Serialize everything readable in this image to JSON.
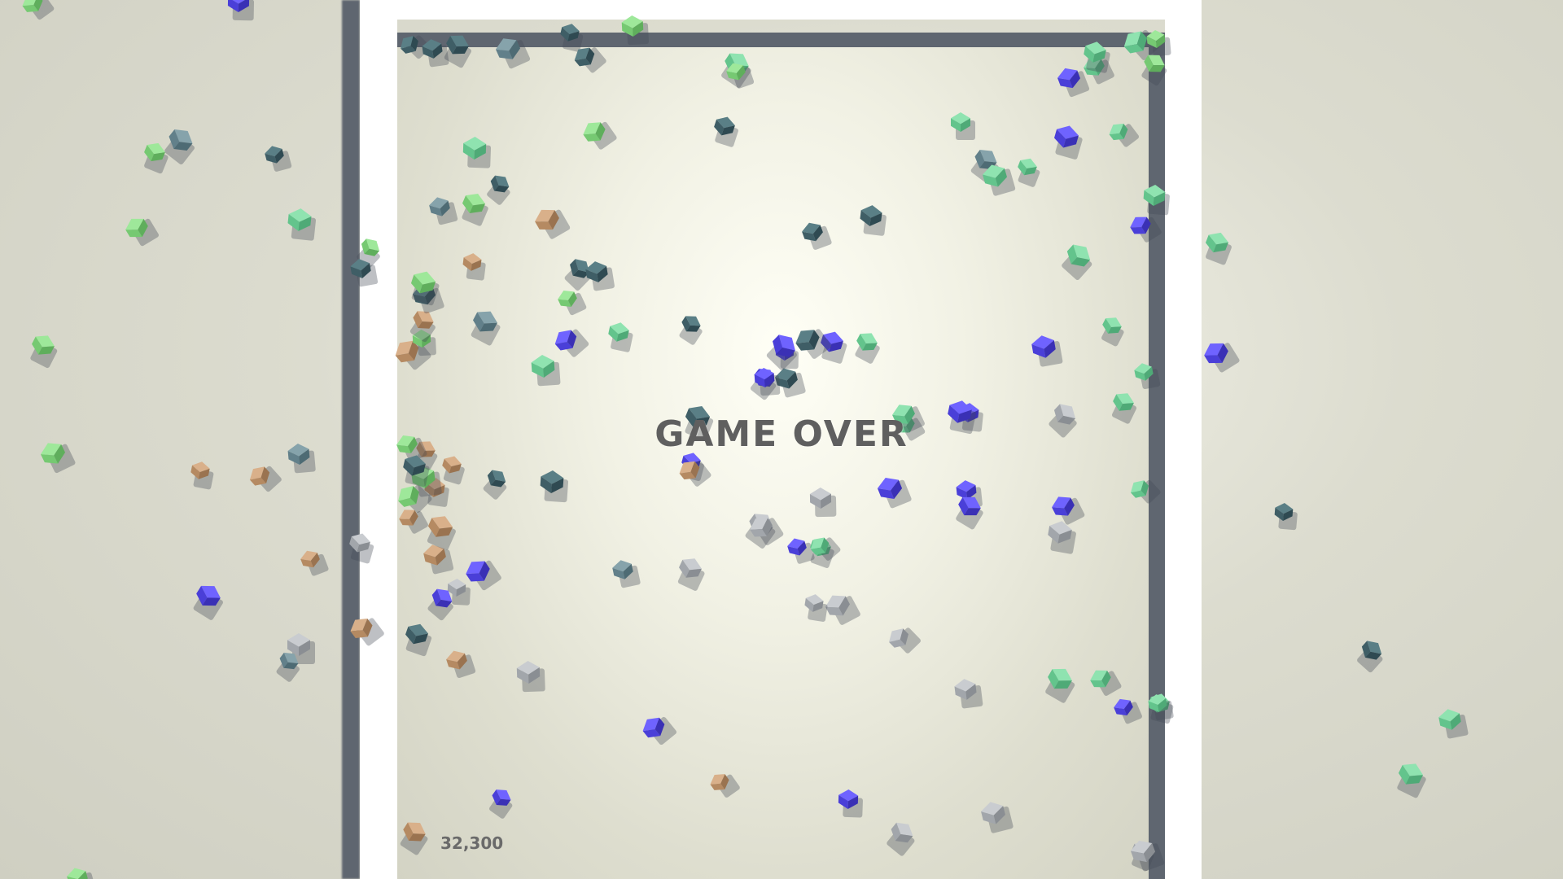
{
  "game": {
    "status_text": "GAME OVER",
    "score": "32,300"
  },
  "colors": {
    "background": "#d6d6c9",
    "arena_wall": "#5f6670",
    "frame": "#ffffff",
    "text": "#5f5f5f"
  }
}
